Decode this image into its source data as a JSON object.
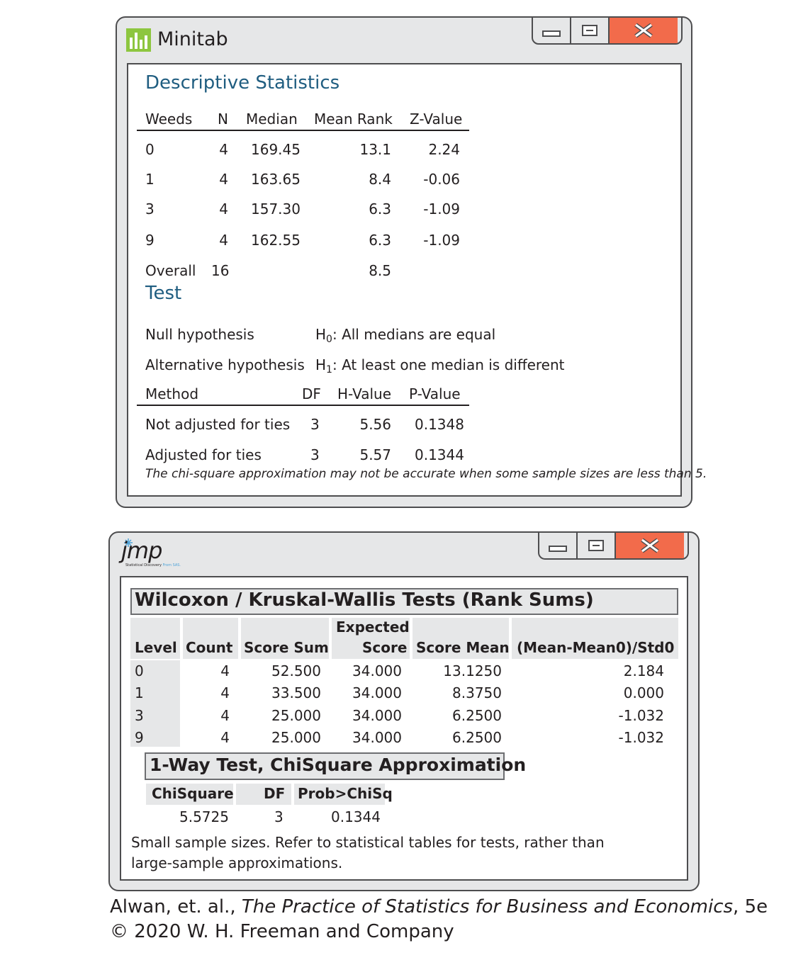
{
  "minitab": {
    "app_title": "Minitab",
    "window_controls": {
      "minimize": "minimize-icon",
      "maximize": "maximize-icon",
      "close": "close-icon"
    },
    "descriptive": {
      "title": "Descriptive Statistics",
      "headers": [
        "Weeds",
        "N",
        "Median",
        "Mean Rank",
        "Z-Value"
      ],
      "rows": [
        [
          "0",
          "4",
          "169.45",
          "13.1",
          "2.24"
        ],
        [
          "1",
          "4",
          "163.65",
          "8.4",
          "-0.06"
        ],
        [
          "3",
          "4",
          "157.30",
          "6.3",
          "-1.09"
        ],
        [
          "9",
          "4",
          "162.55",
          "6.3",
          "-1.09"
        ],
        [
          "Overall",
          "16",
          "",
          "8.5",
          ""
        ]
      ]
    },
    "test": {
      "title": "Test",
      "null_label": "Null hypothesis",
      "null_value": {
        "symbol": "H",
        "sub": "0",
        "rest": ": All medians are equal"
      },
      "alt_label": "Alternative hypothesis",
      "alt_value": {
        "symbol": "H",
        "sub": "1",
        "rest": ": At least one median is different"
      },
      "headers": [
        "Method",
        "DF",
        "H-Value",
        "P-Value"
      ],
      "rows": [
        [
          "Not adjusted for ties",
          "3",
          "5.56",
          "0.1348"
        ],
        [
          "Adjusted for ties",
          "3",
          "5.57",
          "0.1344"
        ]
      ],
      "note": "The chi-square approximation may not be accurate when some sample sizes are less than 5."
    }
  },
  "jmp": {
    "logo_text": "jmp",
    "logo_tagline": "Statistical Discovery",
    "logo_tagline_suffix": "From SAS.",
    "window_controls": {
      "minimize": "minimize-icon",
      "maximize": "maximize-icon",
      "close": "close-icon"
    },
    "wilcoxon": {
      "title": "Wilcoxon / Kruskal-Wallis Tests (Rank Sums)",
      "headers": [
        "Level",
        "Count",
        "Score Sum",
        "Expected",
        "Score",
        "Score Mean",
        "(Mean-Mean0)/Std0"
      ],
      "rows": [
        [
          "0",
          "4",
          "52.500",
          "34.000",
          "13.1250",
          "2.184"
        ],
        [
          "1",
          "4",
          "33.500",
          "34.000",
          "8.3750",
          "0.000"
        ],
        [
          "3",
          "4",
          "25.000",
          "34.000",
          "6.2500",
          "-1.032"
        ],
        [
          "9",
          "4",
          "25.000",
          "34.000",
          "6.2500",
          "-1.032"
        ]
      ]
    },
    "oneway": {
      "title": "1-Way Test, ChiSquare Approximation",
      "headers": [
        "ChiSquare",
        "DF",
        "Prob>ChiSq"
      ],
      "values": [
        "5.5725",
        "3",
        "0.1344"
      ]
    },
    "note_line1": "Small sample sizes. Refer to statistical tables for tests, rather than",
    "note_line2": "large-sample approximations."
  },
  "credit": {
    "authors": "Alwan, et. al., ",
    "book": "The Practice of Statistics for Business and Economics",
    "edition": ", 5e",
    "copyright": "© 2020 W. H. Freeman and Company"
  }
}
